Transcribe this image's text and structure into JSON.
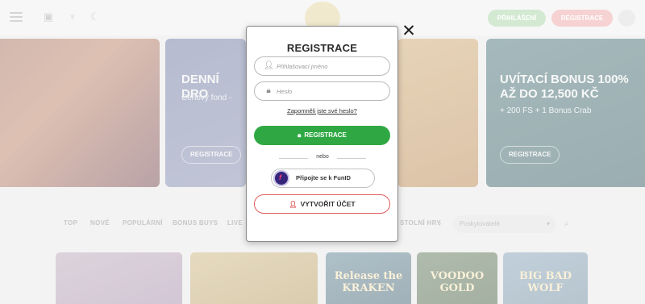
{
  "header": {
    "login_label": "PŘIHLÁŠENÍ",
    "register_label": "REGISTRACE",
    "icons": [
      "menu-icon",
      "gift-icon",
      "trophy-icon",
      "moon-icon"
    ]
  },
  "banners": [
    {
      "title_line1": "",
      "title_line2": "",
      "subtitle": "",
      "button": ""
    },
    {
      "title_line1": "DENNÍ DRO",
      "subtitle": "Cenový fond -",
      "button": "REGISTRACE"
    },
    {
      "title_line1": "",
      "subtitle": "",
      "button": ""
    },
    {
      "title_line1": "UVÍTACÍ BONUS 100%",
      "title_line2": "AŽ DO 12,500 KČ",
      "subtitle": "+ 200 FS + 1 Bonus Crab",
      "button": "REGISTRACE"
    }
  ],
  "categories": [
    "TOP",
    "NOVÉ",
    "POPULÁRNÍ",
    "BONUS BUYS",
    "LIVE",
    "STOLNÍ HRY"
  ],
  "provider_placeholder": "Poskytovatelé",
  "games": [
    "",
    "",
    "Release the KRAKEN",
    "VOODOO GOLD",
    "BIG BAD WOLF"
  ],
  "modal": {
    "title": "REGISTRACE",
    "username_placeholder": "Přihlašovací jméno",
    "password_placeholder": "Heslo",
    "forgot_password": "Zapomněli jste své heslo?",
    "register_button": "REGISTRACE",
    "or_text": "nebo",
    "funid_button": "Připojte se k FunID",
    "create_account_button": "VYTVOŘIT ÚČET",
    "close_icon": "close-icon"
  },
  "colors": {
    "primary_green": "#2fa843",
    "accent_red": "#e05a5a"
  }
}
